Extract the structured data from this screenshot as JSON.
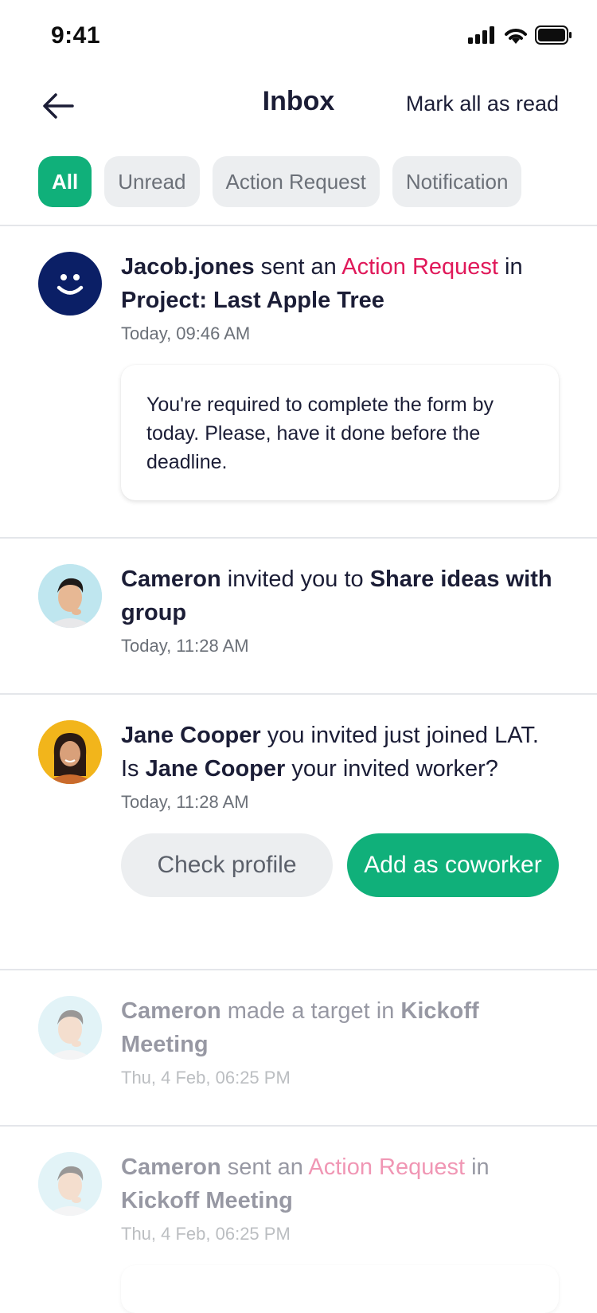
{
  "status_bar": {
    "time": "9:41"
  },
  "header": {
    "title": "Inbox",
    "mark_all": "Mark all as read"
  },
  "tabs": [
    {
      "label": "All",
      "active": true
    },
    {
      "label": "Unread"
    },
    {
      "label": "Action Request"
    },
    {
      "label": "Notification"
    }
  ],
  "colors": {
    "accent_green": "#10b07a",
    "accent_pink": "#e0195a",
    "navy": "#0b1f66"
  },
  "notifications": [
    {
      "actor": "Jacob.jones",
      "verb": " sent an ",
      "highlight": "Action Request",
      "mid": " in",
      "target": "Project: Last Apple Tree",
      "time": "Today, 09:46 AM",
      "note": "You're required to complete the form by today. Please, have it done before the deadline.",
      "avatar_icon": "smiley-icon"
    },
    {
      "actor": "Cameron",
      "verb": " invited you to ",
      "target": "Share ideas with group",
      "time": "Today, 11:28 AM"
    },
    {
      "actor": "Jane Cooper",
      "verb": " you invited just joined LAT. Is ",
      "actor2": "Jane Cooper",
      "tail": " your invited worker?",
      "time": "Today, 11:28 AM",
      "buttons": {
        "secondary": "Check profile",
        "primary": "Add as coworker"
      }
    },
    {
      "actor": "Cameron",
      "verb": " made a target in ",
      "target": "Kickoff Meeting",
      "time": "Thu, 4 Feb, 06:25 PM"
    },
    {
      "actor": "Cameron",
      "verb": " sent an ",
      "highlight": "Action Request",
      "mid": " in",
      "target": "Kickoff Meeting",
      "time": "Thu, 4 Feb, 06:25 PM"
    }
  ]
}
